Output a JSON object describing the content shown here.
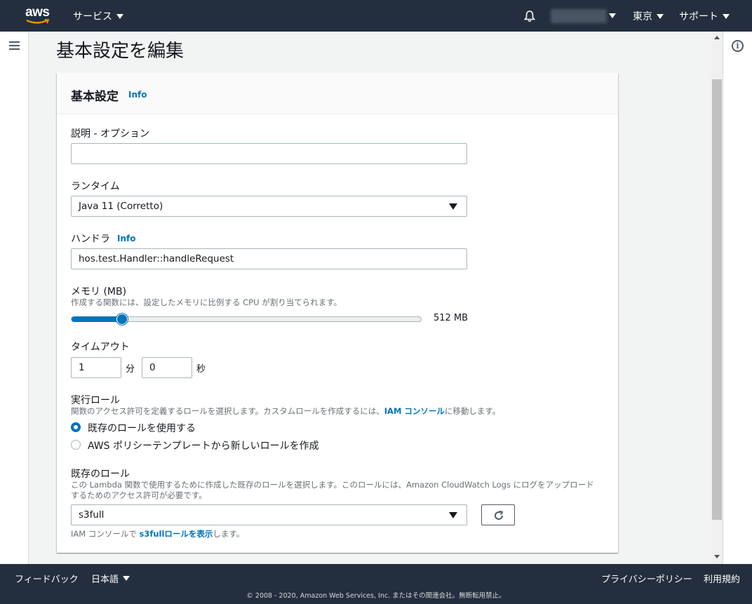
{
  "topnav": {
    "logo_text": "aws",
    "services_label": "サービス",
    "region_label": "東京",
    "support_label": "サポート"
  },
  "page": {
    "title": "基本設定を編集"
  },
  "panel": {
    "title": "基本設定",
    "info_label": "Info",
    "description": {
      "label": "説明 - オプション",
      "value": ""
    },
    "runtime": {
      "label": "ランタイム",
      "value": "Java 11 (Corretto)"
    },
    "handler": {
      "label": "ハンドラ",
      "info_label": "Info",
      "value": "hos.test.Handler::handleRequest"
    },
    "memory": {
      "label": "メモリ (MB)",
      "description": "作成する関数には、設定したメモリに比例する CPU が割り当てられます。",
      "value_text": "512 MB",
      "level": 0.145
    },
    "timeout": {
      "label": "タイムアウト",
      "minutes_value": "1",
      "minutes_unit": "分",
      "seconds_value": "0",
      "seconds_unit": "秒"
    },
    "exec_role": {
      "label": "実行ロール",
      "desc_before": "関数のアクセス許可を定義するロールを選択します。カスタムロールを作成するには、",
      "desc_link": "IAM コンソール",
      "desc_after": "に移動します。",
      "options": [
        {
          "label": "既存のロールを使用する",
          "checked": true
        },
        {
          "label": "AWS ポリシーテンプレートから新しいロールを作成",
          "checked": false
        }
      ]
    },
    "existing_role": {
      "label": "既存のロール",
      "desc_line1": "この Lambda 関数で使用するために作成した既存のロールを選択します。このロールには、Amazon CloudWatch Logs にログをアップロード",
      "desc_line2": "するためのアクセス許可が必要です。",
      "value": "s3full",
      "hint_before": "IAM コンソールで ",
      "hint_link": "s3fullロールを表示",
      "hint_after": "します。"
    }
  },
  "footer": {
    "feedback": "フィードバック",
    "language": "日本語",
    "privacy": "プライバシーポリシー",
    "terms": "利用規約",
    "copyright": "© 2008 - 2020, Amazon Web Services, Inc. またはその関連会社。無断転用禁止。"
  },
  "colors": {
    "nav_bg": "#232f3e",
    "accent": "#0073bb",
    "page_bg": "#f2f3f3"
  }
}
